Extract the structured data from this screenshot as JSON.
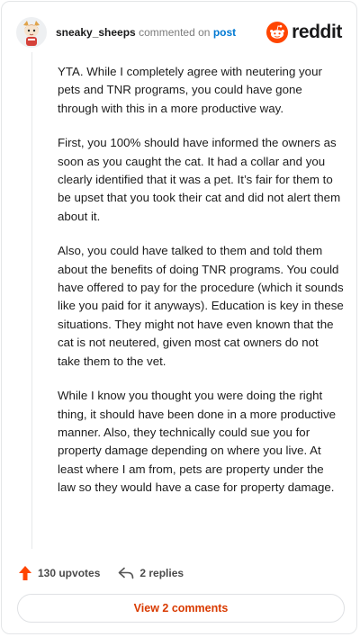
{
  "header": {
    "username": "sneaky_sheeps",
    "action": "commented on",
    "post_link": "post",
    "brand": "reddit"
  },
  "comment": {
    "paragraphs": [
      "YTA. While I completely agree with neutering your pets and TNR programs, you could have gone through with this in a more productive way.",
      "First, you 100% should have informed the owners as soon as you caught the cat. It had a collar and you clearly identified that it was a pet. It’s fair for them to be upset that you took their cat and did not alert them about it.",
      "Also, you could have talked to them and told them about the benefits of doing TNR programs. You could have offered to pay for the procedure (which it sounds like you paid for it anyways). Education is key in these situations. They might not have even known that the cat is not neutered, given most cat owners do not take them to the vet.",
      "While I know you thought you were doing the right thing, it should have been done in a more productive manner. Also, they technically could sue you for property damage depending on where you live. At least where I am from, pets are property under the law so they would have a case for property damage."
    ]
  },
  "actions": {
    "upvotes": "130 upvotes",
    "replies": "2 replies"
  },
  "view_button": "View 2 comments",
  "icons": {
    "brand": "reddit-snoo-icon",
    "upvote": "upvote-arrow-icon",
    "reply": "reply-arrow-icon",
    "avatar": "user-avatar-icon"
  },
  "colors": {
    "accent": "#ff4500",
    "link": "#0079d3",
    "button_text": "#d93a00"
  }
}
